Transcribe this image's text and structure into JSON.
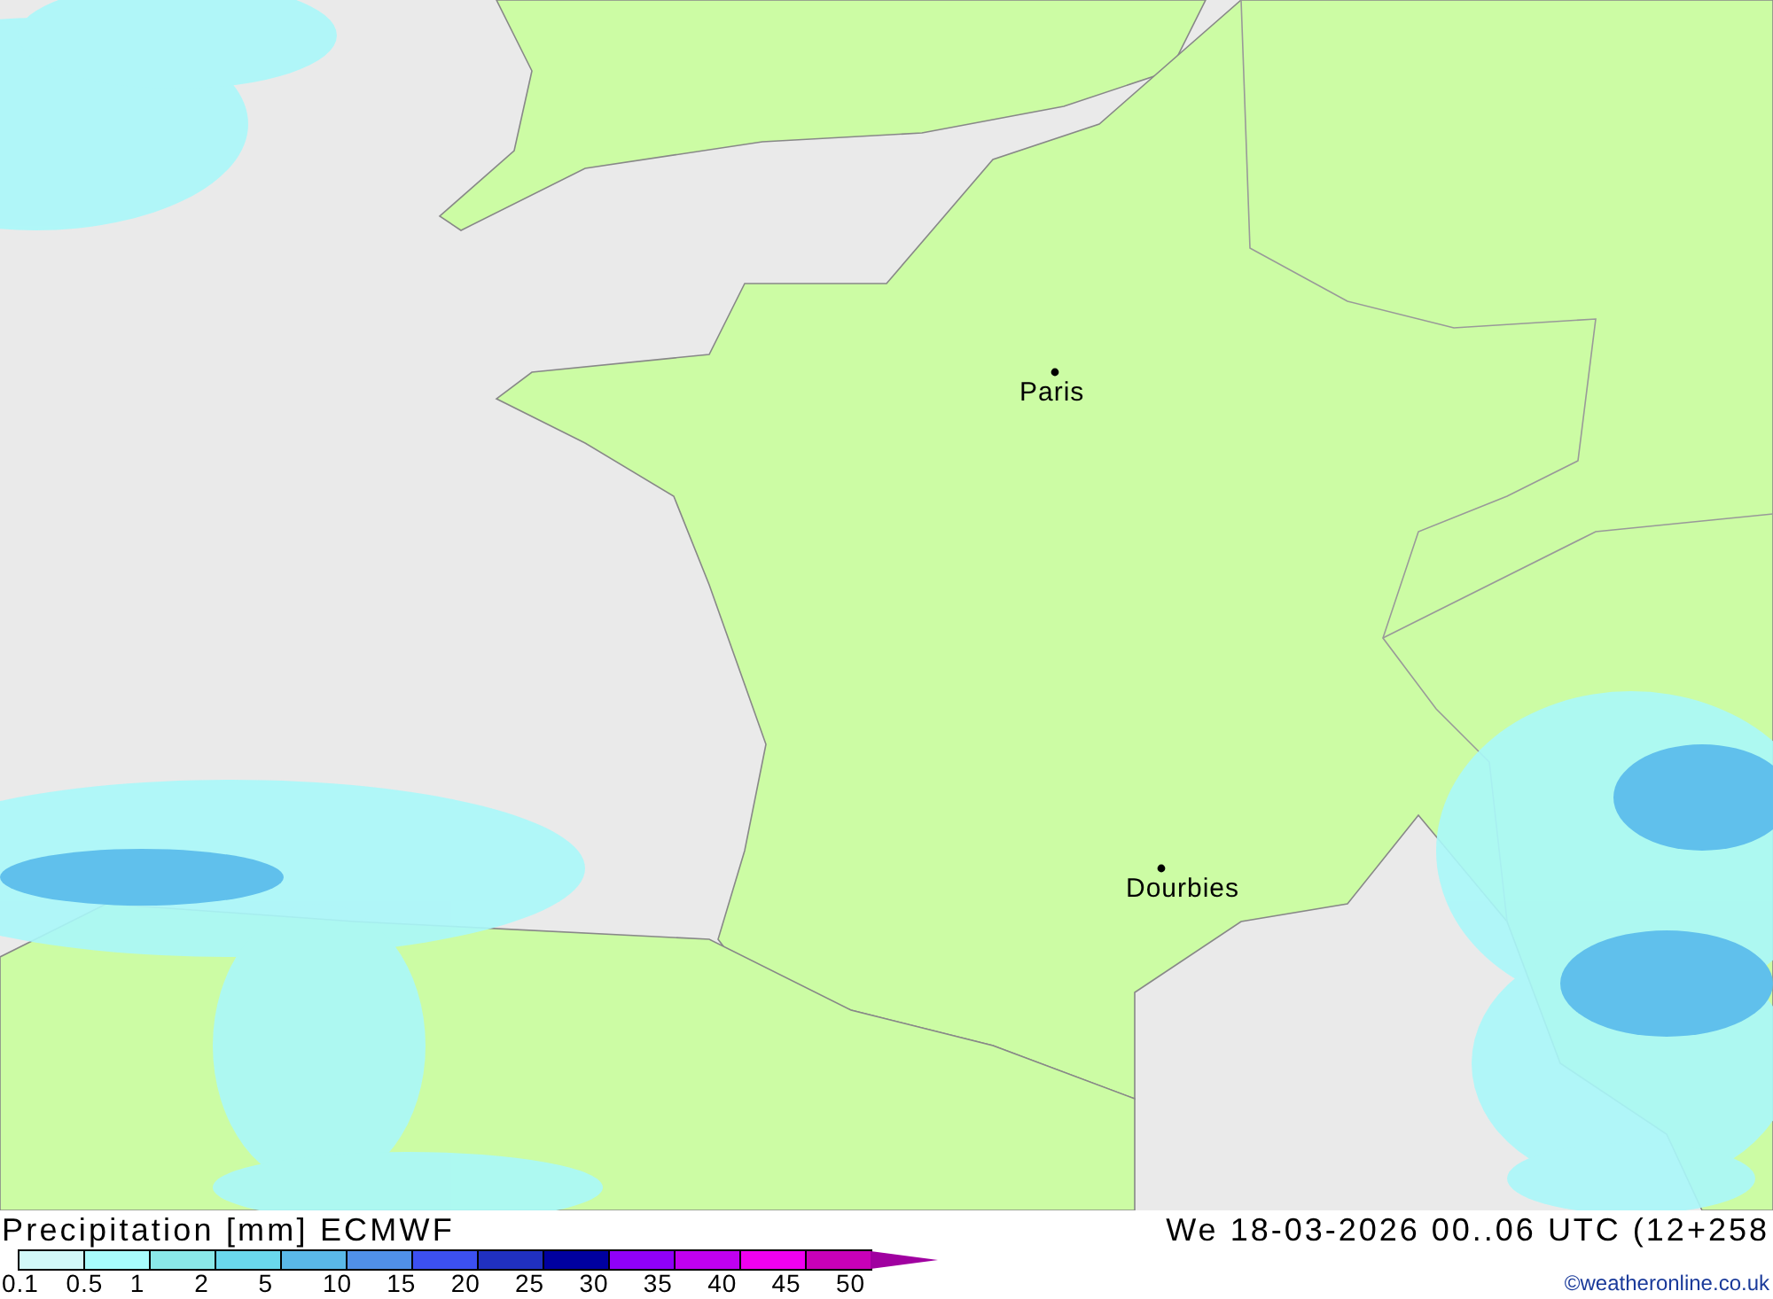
{
  "map": {
    "cities": [
      {
        "name": "Paris"
      },
      {
        "name": "Dourbies"
      }
    ]
  },
  "footer": {
    "title": "Precipitation [mm] ECMWF",
    "datetime": "We 18-03-2026 00..06 UTC (12+258",
    "credit": "©weatheronline.co.uk",
    "legend": {
      "labels": [
        "0.1",
        "0.5",
        "1",
        "2",
        "5",
        "10",
        "15",
        "20",
        "25",
        "30",
        "35",
        "40",
        "45",
        "50"
      ],
      "swatches": [
        {
          "color": "#d2f8f8"
        },
        {
          "color": "#a8fcfc"
        },
        {
          "color": "#8ae8e8"
        },
        {
          "color": "#6ad8ec"
        },
        {
          "color": "#5ab8e8"
        },
        {
          "color": "#5090e8"
        },
        {
          "color": "#3c50f0"
        },
        {
          "color": "#2030c0"
        },
        {
          "color": "#0000a0"
        },
        {
          "color": "#9000f8"
        },
        {
          "color": "#c000f0"
        },
        {
          "color": "#f000f0"
        },
        {
          "color": "#c800b8"
        }
      ],
      "arrow": {
        "color": "#a000a0"
      }
    }
  }
}
